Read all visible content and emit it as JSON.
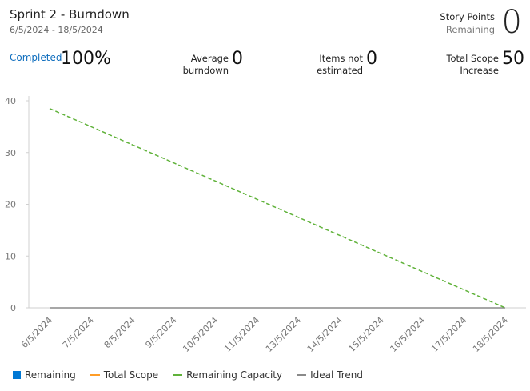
{
  "header": {
    "title": "Sprint 2 - Burndown",
    "date_range": "6/5/2024 - 18/5/2024",
    "story_points_label": "Story Points",
    "story_points_sub": "Remaining",
    "story_points_value": "0"
  },
  "metrics": {
    "completed_label": "Completed",
    "completed_value": "100%",
    "avg_burndown_label_1": "Average",
    "avg_burndown_label_2": "burndown",
    "avg_burndown_value": "0",
    "not_estimated_label_1": "Items not",
    "not_estimated_label_2": "estimated",
    "not_estimated_value": "0",
    "scope_increase_label_1": "Total Scope",
    "scope_increase_label_2": "Increase",
    "scope_increase_value": "50"
  },
  "colors": {
    "remaining": "#0078d4",
    "total_scope": "#ff9d27",
    "remaining_capacity": "#60b23a",
    "ideal_trend": "#8a8a8a",
    "grid": "#e6e6e6",
    "axis_text": "#767676"
  },
  "chart_data": {
    "type": "line",
    "title": "",
    "xlabel": "",
    "ylabel": "",
    "categories": [
      "6/5/2024",
      "7/5/2024",
      "8/5/2024",
      "9/5/2024",
      "10/5/2024",
      "11/5/2024",
      "13/5/2024",
      "14/5/2024",
      "15/5/2024",
      "16/5/2024",
      "17/5/2024",
      "18/5/2024"
    ],
    "ylim": [
      0,
      40
    ],
    "yticks": [
      0,
      10,
      20,
      30,
      40
    ],
    "grid": false,
    "legend_position": "bottom",
    "series": [
      {
        "name": "Remaining",
        "style": "box",
        "values": [
          0,
          0,
          0,
          0,
          0,
          0,
          0,
          0,
          0,
          0,
          0,
          0
        ]
      },
      {
        "name": "Total Scope",
        "style": "line",
        "values": []
      },
      {
        "name": "Remaining Capacity",
        "style": "dashed",
        "values": [
          38.5,
          35,
          31.5,
          28,
          24.5,
          21,
          17.5,
          14,
          10.5,
          7,
          3.5,
          0
        ]
      },
      {
        "name": "Ideal Trend",
        "style": "line",
        "values": [
          0,
          0,
          0,
          0,
          0,
          0,
          0,
          0,
          0,
          0,
          0,
          0
        ]
      }
    ]
  }
}
